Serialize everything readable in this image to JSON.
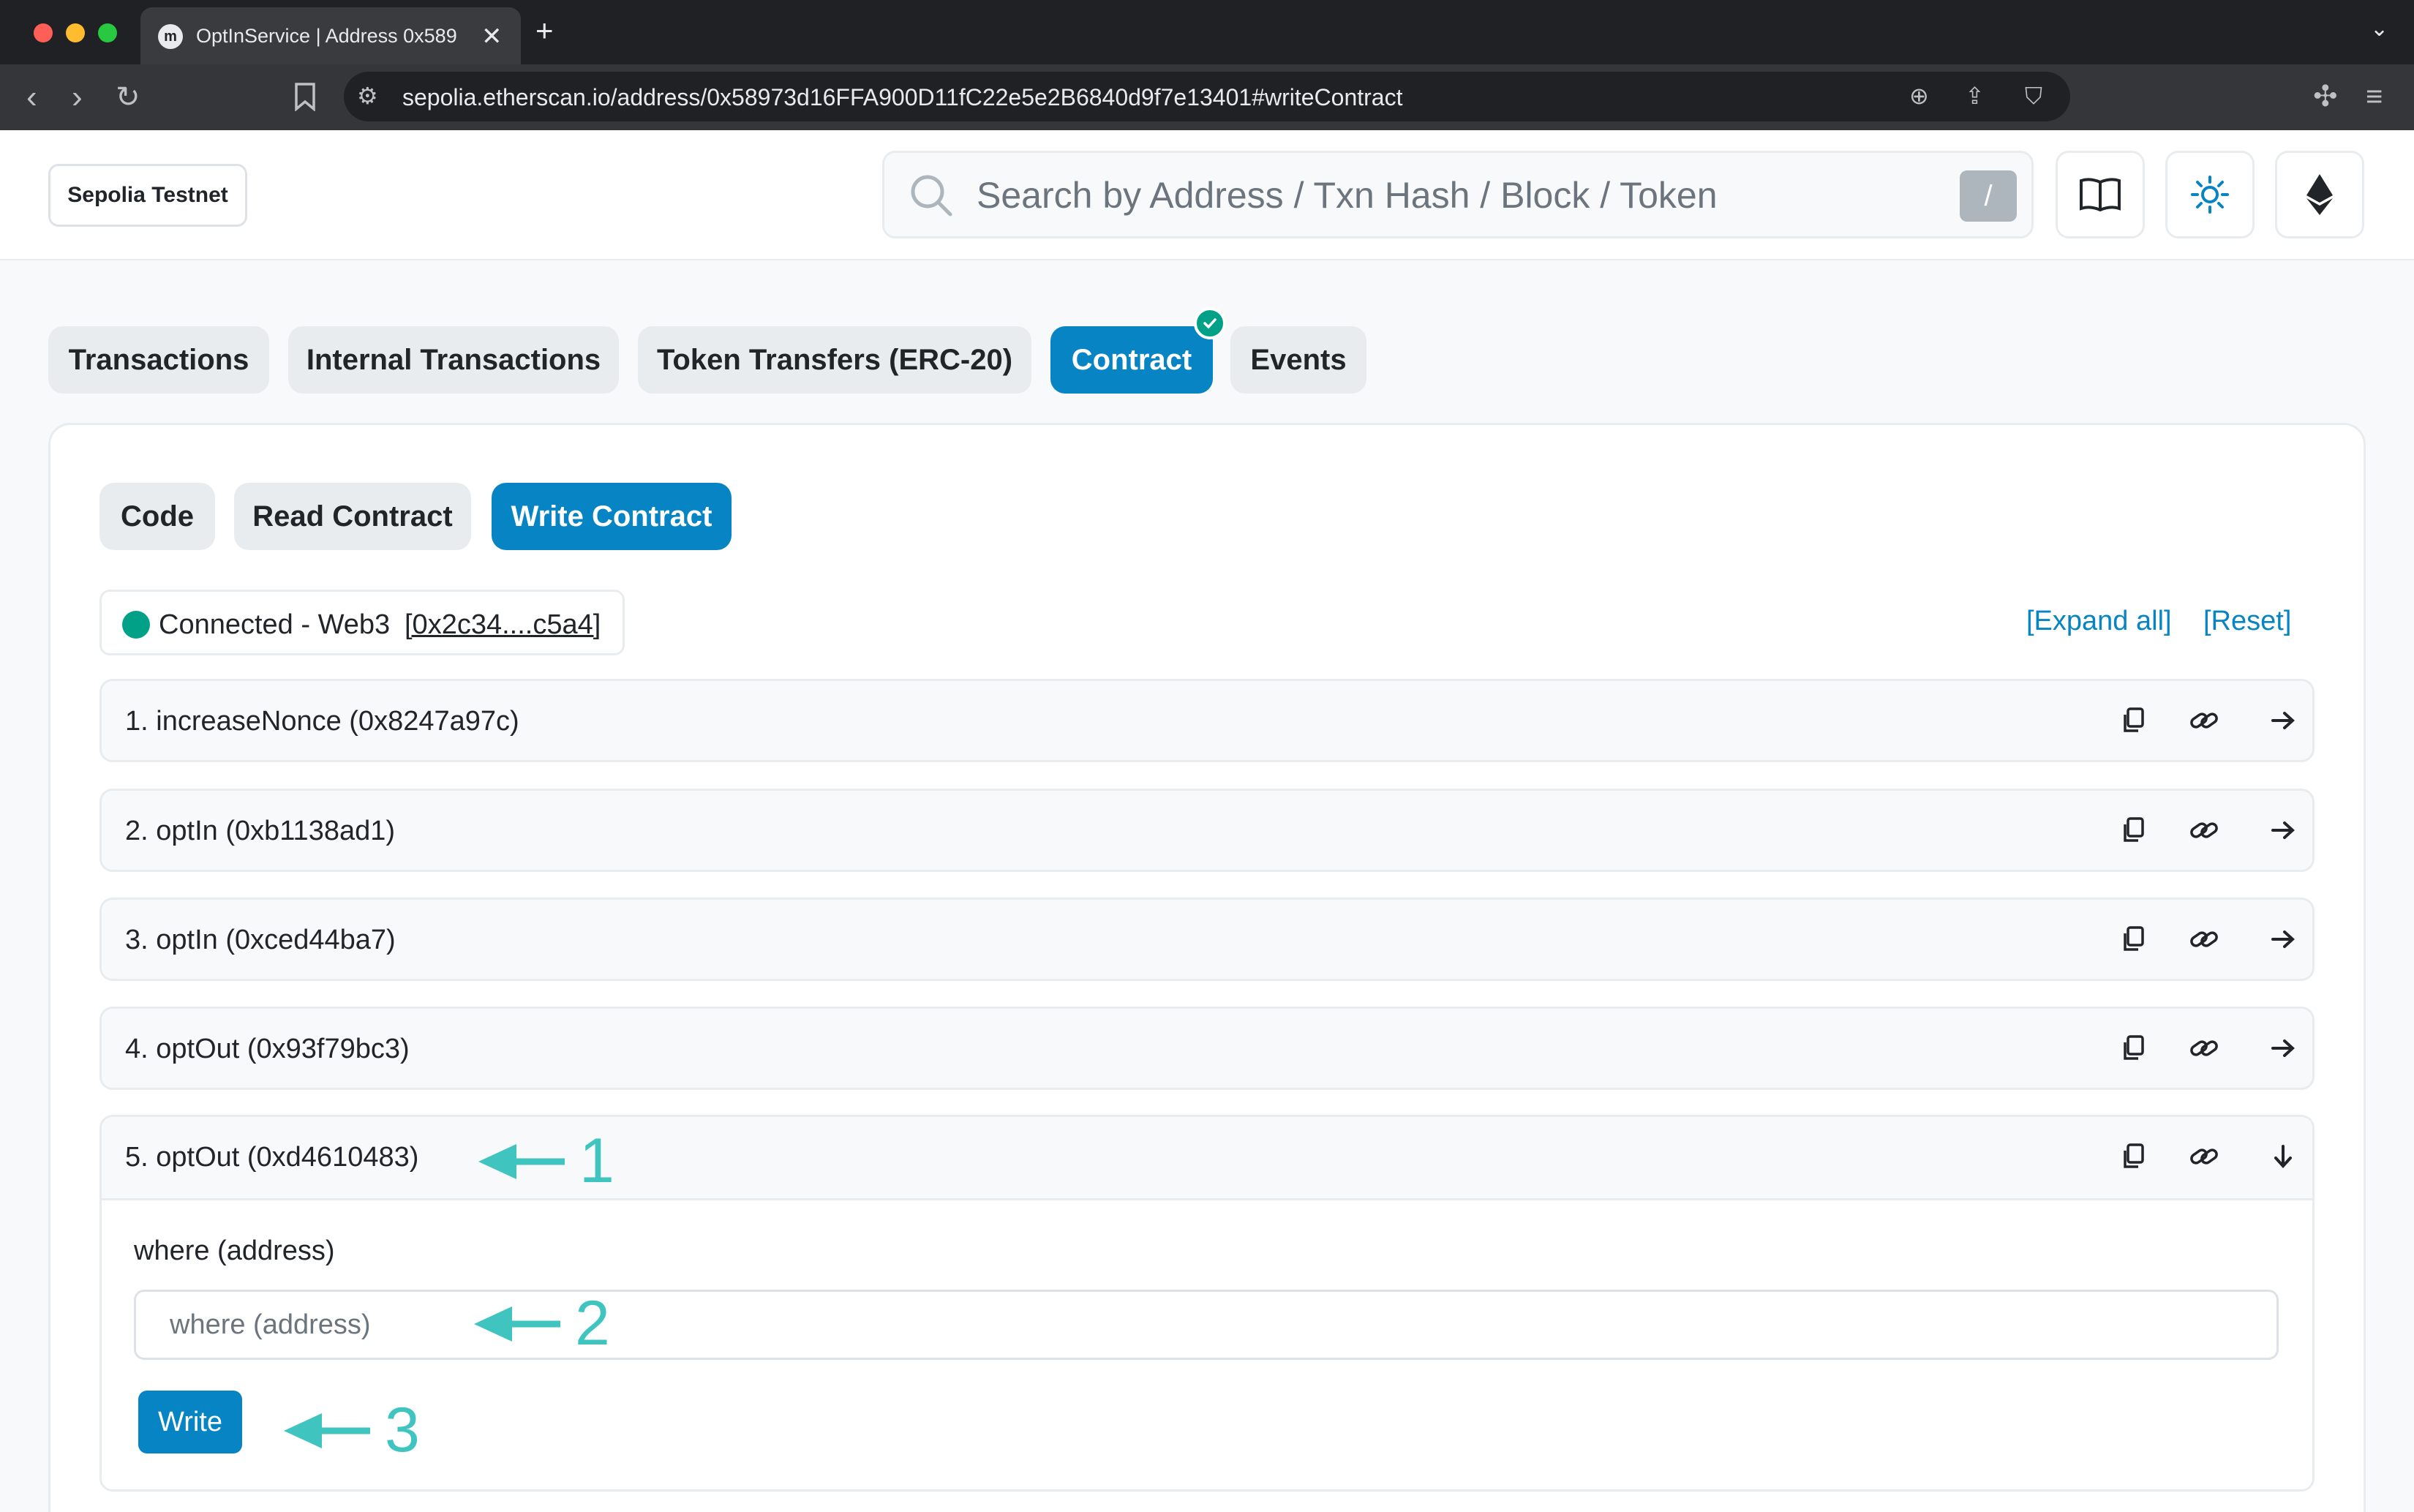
{
  "browser": {
    "tab_title": "OptInService | Address 0x589",
    "url": "sepolia.etherscan.io/address/0x58973d16FFA900D11fC22e5e2B6840d9f7e13401#writeContract"
  },
  "header": {
    "network": "Sepolia Testnet",
    "search_placeholder": "Search by Address / Txn Hash / Block / Token",
    "search_shortcut": "/"
  },
  "tabs": [
    {
      "label": "Transactions",
      "active": false
    },
    {
      "label": "Internal Transactions",
      "active": false
    },
    {
      "label": "Token Transfers (ERC-20)",
      "active": false
    },
    {
      "label": "Contract",
      "active": true
    },
    {
      "label": "Events",
      "active": false
    }
  ],
  "subtabs": [
    {
      "label": "Code",
      "active": false
    },
    {
      "label": "Read Contract",
      "active": false
    },
    {
      "label": "Write Contract",
      "active": true
    }
  ],
  "connection": {
    "status": "Connected - Web3",
    "address": "[0x2c34....c5a4]",
    "expand_all": "[Expand all]",
    "reset": "[Reset]"
  },
  "functions": [
    {
      "label": "1. increaseNonce (0x8247a97c)"
    },
    {
      "label": "2. optIn (0xb1138ad1)"
    },
    {
      "label": "3. optIn (0xced44ba7)"
    },
    {
      "label": "4. optOut (0x93f79bc3)"
    },
    {
      "label": "5. optOut (0xd4610483)"
    }
  ],
  "expanded_function": {
    "param_label": "where (address)",
    "param_placeholder": "where (address)",
    "write_label": "Write"
  },
  "annotations": [
    "1",
    "2",
    "3"
  ],
  "colors": {
    "primary": "#0784c3",
    "success": "#00a186",
    "annotation": "#3fc4c0"
  }
}
